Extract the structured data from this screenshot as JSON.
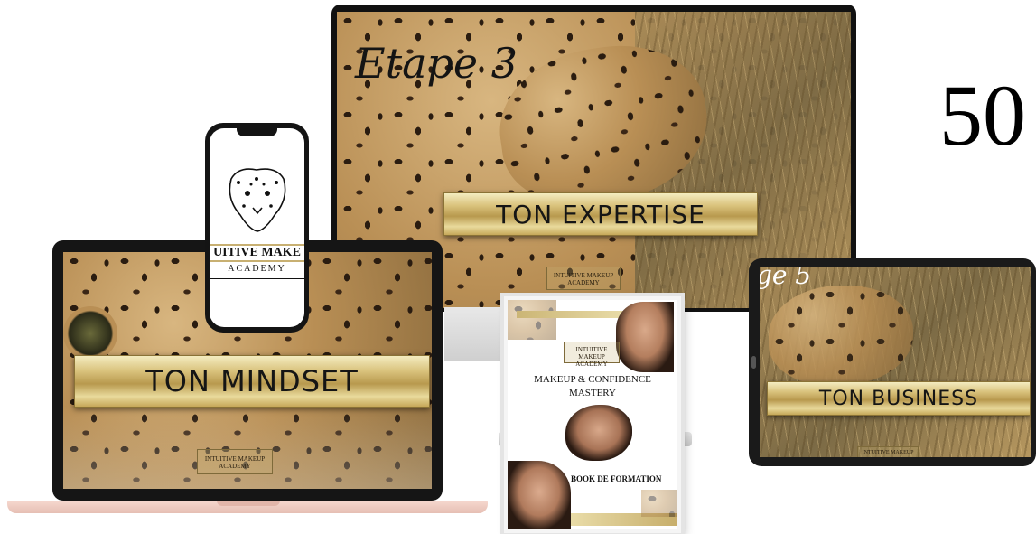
{
  "monitor": {
    "script_label": "Etape 3",
    "banner": "TON EXPERTISE",
    "logo_line1": "INTUITIVE MAKEUP",
    "logo_line2": "ACADEMY"
  },
  "side_number": "50",
  "laptop": {
    "banner": "TON MINDSET",
    "logo_line1": "INTUITIVE MAKEUP",
    "logo_line2": "ACADEMY"
  },
  "phone": {
    "brand_line1": "UITIVE MAKE",
    "brand_line2": "ACADEMY"
  },
  "tablet": {
    "script_label": "ge 5",
    "banner": "TON BUSINESS",
    "logo_line1": "INTUITIVE MAKEUP"
  },
  "book": {
    "logo_line1": "INTUITIVE MAKEUP",
    "logo_line2": "ACADEMY",
    "title_line1": "MAKEUP & CONFIDENCE",
    "title_line2": "MASTERY",
    "subtitle": "BOOK DE FORMATION"
  }
}
